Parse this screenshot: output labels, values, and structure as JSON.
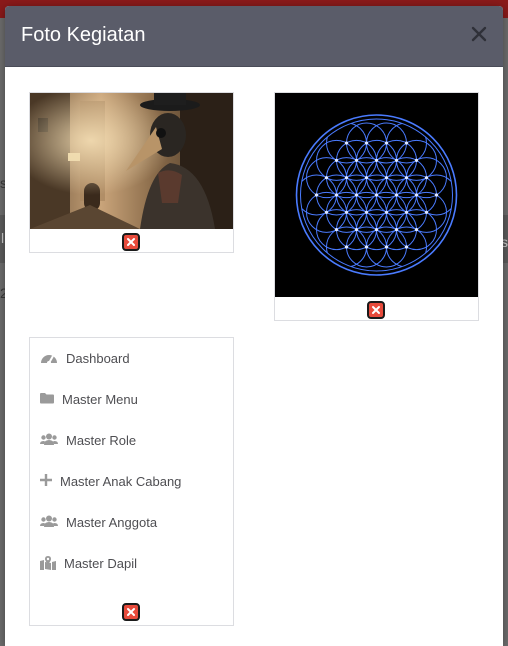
{
  "modal": {
    "title": "Foto Kegiatan"
  },
  "photos": [
    {
      "name": "plague-doctor-photo"
    },
    {
      "name": "flower-of-life-photo"
    }
  ],
  "menu": {
    "items": [
      {
        "label": "Dashboard",
        "icon": "tachometer-icon"
      },
      {
        "label": "Master Menu",
        "icon": "folder-icon"
      },
      {
        "label": "Master Role",
        "icon": "users-icon"
      },
      {
        "label": "Master Anak Cabang",
        "icon": "plus-icon"
      },
      {
        "label": "Master Anggota",
        "icon": "users-icon"
      },
      {
        "label": "Master Dapil",
        "icon": "map-marked-icon"
      }
    ]
  },
  "background": {
    "side_letters": [
      "s",
      "l",
      "2",
      "s"
    ]
  },
  "colors": {
    "header": "#5a5c69",
    "delete": "#e74a3b",
    "topbar": "#8b1a1a",
    "icon_blue": "#4a7bff"
  }
}
